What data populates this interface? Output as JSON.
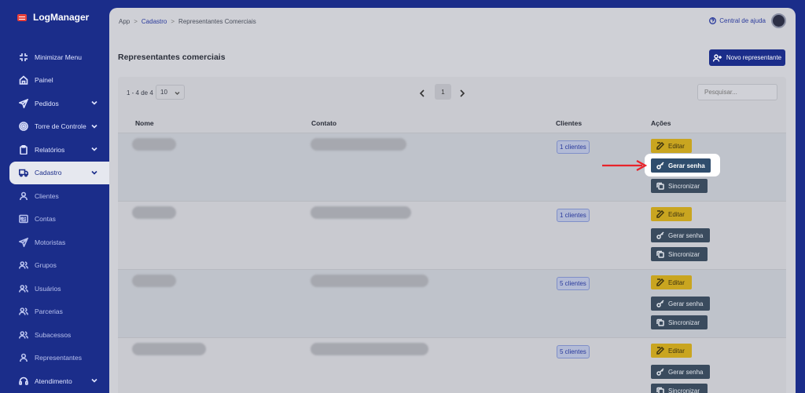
{
  "app": {
    "name": "LogManager"
  },
  "sidebar": {
    "items": [
      {
        "label": "Minimizar Menu",
        "icon": "minimize-icon"
      },
      {
        "label": "Painel",
        "icon": "home-icon"
      },
      {
        "label": "Pedidos",
        "icon": "send-icon",
        "chevron": true
      },
      {
        "label": "Torre de Controle",
        "icon": "target-icon",
        "chevron": true
      },
      {
        "label": "Relatórios",
        "icon": "clipboard-icon",
        "chevron": true
      },
      {
        "label": "Cadastro",
        "icon": "truck-icon",
        "chevron": true,
        "active": true
      },
      {
        "label": "Clientes",
        "icon": "user-icon",
        "sub": true
      },
      {
        "label": "Contas",
        "icon": "card-icon",
        "sub": true
      },
      {
        "label": "Motoristas",
        "icon": "send-icon",
        "sub": true
      },
      {
        "label": "Grupos",
        "icon": "users-icon",
        "sub": true
      },
      {
        "label": "Usuários",
        "icon": "users-icon",
        "sub": true
      },
      {
        "label": "Parcerias",
        "icon": "users-icon",
        "sub": true
      },
      {
        "label": "Subacessos",
        "icon": "users-icon",
        "sub": true
      },
      {
        "label": "Representantes",
        "icon": "user-icon",
        "sub": true
      },
      {
        "label": "Atendimento",
        "icon": "headset-icon",
        "chevron": true
      }
    ]
  },
  "breadcrumb": {
    "root": "App",
    "section": "Cadastro",
    "current": "Representantes Comerciais"
  },
  "header": {
    "help": "Central de ajuda"
  },
  "page": {
    "title": "Representantes comerciais",
    "new_button": "Novo representante"
  },
  "table": {
    "count": "1 - 4 de 4",
    "per_page": "10",
    "current_page": "1",
    "search_placeholder": "Pesquisar...",
    "columns": {
      "name": "Nome",
      "contact": "Contato",
      "clients": "Clientes",
      "actions": "Ações"
    },
    "rows": [
      {
        "clients": "1 clientes"
      },
      {
        "clients": "1 clientes"
      },
      {
        "clients": "5 clientes"
      },
      {
        "clients": "5 clientes"
      }
    ],
    "actions": {
      "edit": "Editar",
      "password": "Gerar senha",
      "sync": "Sincronizar"
    }
  },
  "colors": {
    "sidebar": "#1b2d8a",
    "accent": "#1b2d8a",
    "edit": "#c9a520",
    "dark_button": "#3a4b5e",
    "arrow": "#e8232a"
  }
}
